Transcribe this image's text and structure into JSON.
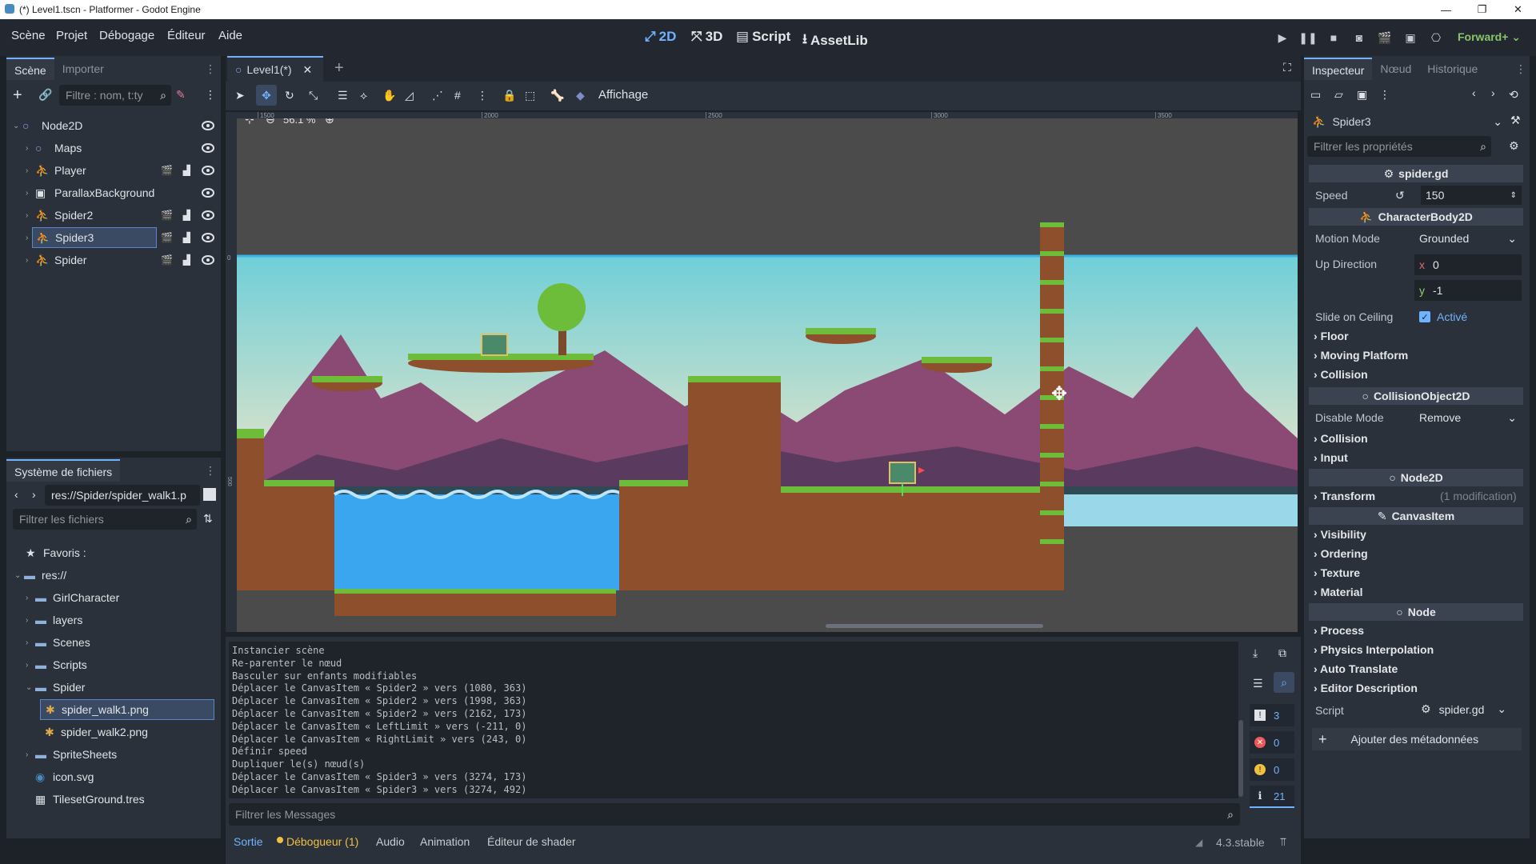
{
  "window": {
    "title": "(*) Level1.tscn - Platformer - Godot Engine",
    "minimize": "—",
    "maximize": "❐",
    "close": "✕"
  },
  "menu": [
    "Scène",
    "Projet",
    "Débogage",
    "Éditeur",
    "Aide"
  ],
  "modes": {
    "m2d": "2D",
    "m3d": "3D",
    "script": "Script",
    "assetlib": "AssetLib"
  },
  "renderer": "Forward+",
  "scene_panel": {
    "tabs": [
      "Scène",
      "Importer"
    ],
    "filter_placeholder": "Filtre : nom, t:ty",
    "nodes": [
      {
        "name": "Node2D",
        "icon": "circle-icon"
      },
      {
        "name": "Maps",
        "icon": "circle-icon"
      },
      {
        "name": "Player",
        "icon": "body-icon"
      },
      {
        "name": "ParallaxBackground",
        "icon": "parallax-icon"
      },
      {
        "name": "Spider2",
        "icon": "body-icon"
      },
      {
        "name": "Spider3",
        "icon": "body-icon"
      },
      {
        "name": "Spider",
        "icon": "body-icon"
      }
    ]
  },
  "filesystem": {
    "title": "Système de fichiers",
    "path": "res://Spider/spider_walk1.p",
    "filter_placeholder": "Filtrer les fichiers",
    "favorites": "Favoris :",
    "root": "res://",
    "items": [
      "GirlCharacter",
      "layers",
      "Scenes",
      "Scripts",
      "Spider",
      "spider_walk1.png",
      "spider_walk2.png",
      "SpriteSheets",
      "icon.svg",
      "TilesetGround.tres"
    ]
  },
  "editor": {
    "tab": "Level1(*)",
    "add_tab": "+",
    "affichage": "Affichage",
    "zoom": "56.1 %",
    "ruler_ticks": [
      "1500",
      "2000",
      "2500",
      "3000",
      "3500"
    ],
    "ruler_left": [
      "0",
      "500"
    ]
  },
  "console": {
    "lines": [
      "Instancier scène",
      "Re-parenter le nœud",
      "Basculer sur enfants modifiables",
      "Déplacer le CanvasItem « Spider2 » vers (1080, 363)",
      "Déplacer le CanvasItem « Spider2 » vers (1998, 363)",
      "Déplacer le CanvasItem « Spider2 » vers (2162, 173)",
      "Déplacer le CanvasItem « LeftLimit » vers (-211, 0)",
      "Déplacer le CanvasItem « RightLimit » vers (243, 0)",
      "Définir speed",
      "Dupliquer le(s) nœud(s)",
      "Déplacer le CanvasItem « Spider3 » vers (3274, 173)",
      "Déplacer le CanvasItem « Spider3 » vers (3274, 492)"
    ],
    "filter_placeholder": "Filtrer les Messages",
    "counts": {
      "messages": "3",
      "errors": "0",
      "warnings": "0",
      "info": "21"
    }
  },
  "bottom_tabs": [
    "Sortie",
    "Débogueur (1)",
    "Audio",
    "Animation",
    "Éditeur de shader"
  ],
  "version": "4.3.stable",
  "inspector": {
    "tabs": [
      "Inspecteur",
      "Nœud",
      "Historique"
    ],
    "node": "Spider3",
    "filter_placeholder": "Filtrer les propriétés",
    "script_header": "spider.gd",
    "speed_label": "Speed",
    "speed_value": "150",
    "body_header": "CharacterBody2D",
    "motion_mode_label": "Motion Mode",
    "motion_mode_value": "Grounded",
    "up_direction_label": "Up Direction",
    "up_x_label": "x",
    "up_x": "0",
    "up_y_label": "y",
    "up_y": "-1",
    "slide_label": "Slide on Ceiling",
    "slide_value": "Activé",
    "groups1": [
      "Floor",
      "Moving Platform",
      "Collision"
    ],
    "collision_header": "CollisionObject2D",
    "disable_mode_label": "Disable Mode",
    "disable_mode_value": "Remove",
    "groups2": [
      "Collision",
      "Input"
    ],
    "node2d_header": "Node2D",
    "transform_label": "Transform",
    "transform_note": "(1 modification)",
    "canvas_header": "CanvasItem",
    "groups3": [
      "Visibility",
      "Ordering",
      "Texture",
      "Material"
    ],
    "node_header": "Node",
    "groups4": [
      "Process",
      "Physics Interpolation",
      "Auto Translate",
      "Editor Description"
    ],
    "script_label": "Script",
    "script_value": "spider.gd",
    "add_meta": "Ajouter des métadonnées"
  },
  "colors": {
    "accent": "#6fb3ff",
    "bg": "#1d2229",
    "panel": "#2b313a"
  }
}
